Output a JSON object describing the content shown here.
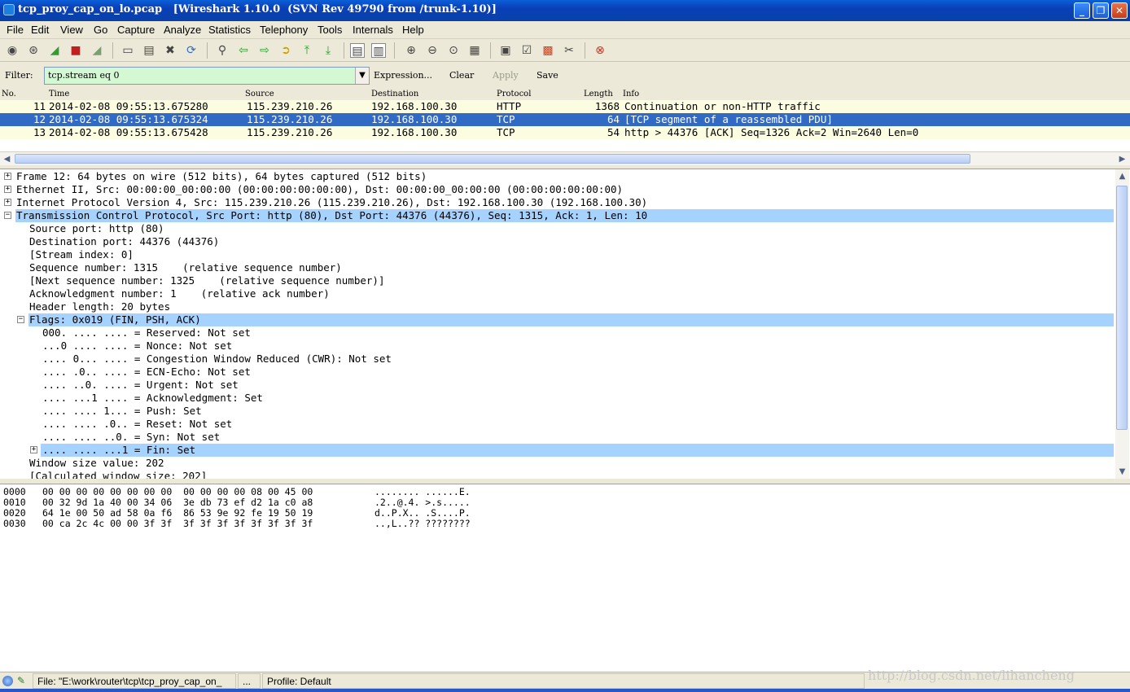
{
  "window": {
    "title": "tcp_proy_cap_on_lo.pcap   [Wireshark 1.10.0  (SVN Rev 49790 from /trunk-1.10)]",
    "icons": {
      "minimize": "minimize-icon",
      "maximize": "restore-icon",
      "close": "close-icon"
    }
  },
  "menu": [
    "File",
    "Edit",
    "View",
    "Go",
    "Capture",
    "Analyze",
    "Statistics",
    "Telephony",
    "Tools",
    "Internals",
    "Help"
  ],
  "toolbar": {
    "icons": [
      "interfaces-icon",
      "options-icon",
      "start-capture-icon",
      "stop-capture-icon",
      "restart-capture-icon",
      "open-file-icon",
      "save-file-icon",
      "close-file-icon",
      "reload-icon",
      "find-packet-icon",
      "go-back-icon",
      "go-forward-icon",
      "go-to-packet-icon",
      "first-packet-icon",
      "last-packet-icon",
      "colorize-icon",
      "auto-scroll-icon",
      "zoom-in-icon",
      "zoom-out-icon",
      "normal-size-icon",
      "resize-columns-icon",
      "capture-filters-icon",
      "display-filters-icon",
      "coloring-rules-icon",
      "preferences-icon",
      "help-icon"
    ]
  },
  "filter": {
    "label": "Filter:",
    "value": "tcp.stream eq 0",
    "expression": "Expression...",
    "clear": "Clear",
    "apply": "Apply",
    "save": "Save"
  },
  "packet_list": {
    "headers": [
      "No.",
      "Time",
      "Source",
      "Destination",
      "Protocol",
      "Length",
      "Info"
    ],
    "rows": [
      {
        "no": "11",
        "time": "2014-02-08 09:55:13.675280",
        "source": "115.239.210.26",
        "destination": "192.168.100.30",
        "protocol": "HTTP",
        "length": "1368",
        "info": "Continuation or non-HTTP traffic"
      },
      {
        "no": "12",
        "time": "2014-02-08 09:55:13.675324",
        "source": "115.239.210.26",
        "destination": "192.168.100.30",
        "protocol": "TCP",
        "length": "64",
        "info": "[TCP segment of a reassembled PDU]"
      },
      {
        "no": "13",
        "time": "2014-02-08 09:55:13.675428",
        "source": "115.239.210.26",
        "destination": "192.168.100.30",
        "protocol": "TCP",
        "length": "54",
        "info": "http > 44376 [ACK] Seq=1326 Ack=2 Win=2640 Len=0"
      }
    ],
    "colors": {
      "row_bg": "#fcfce0",
      "selected_bg": "#316ac5",
      "selected_fg": "#ffffff"
    }
  },
  "details": {
    "lines": [
      "Frame 12: 64 bytes on wire (512 bits), 64 bytes captured (512 bits)",
      "Ethernet II, Src: 00:00:00_00:00:00 (00:00:00:00:00:00), Dst: 00:00:00_00:00:00 (00:00:00:00:00:00)",
      "Internet Protocol Version 4, Src: 115.239.210.26 (115.239.210.26), Dst: 192.168.100.30 (192.168.100.30)",
      "Transmission Control Protocol, Src Port: http (80), Dst Port: 44376 (44376), Seq: 1315, Ack: 1, Len: 10",
      "Source port: http (80)",
      "Destination port: 44376 (44376)",
      "[Stream index: 0]",
      "Sequence number: 1315    (relative sequence number)",
      "[Next sequence number: 1325    (relative sequence number)]",
      "Acknowledgment number: 1    (relative ack number)",
      "Header length: 20 bytes",
      "Flags: 0x019 (FIN, PSH, ACK)",
      "000. .... .... = Reserved: Not set",
      "...0 .... .... = Nonce: Not set",
      ".... 0... .... = Congestion Window Reduced (CWR): Not set",
      ".... .0.. .... = ECN-Echo: Not set",
      ".... ..0. .... = Urgent: Not set",
      ".... ...1 .... = Acknowledgment: Set",
      ".... .... 1... = Push: Set",
      ".... .... .0.. = Reset: Not set",
      ".... .... ..0. = Syn: Not set",
      ".... .... ...1 = Fin: Set",
      "Window size value: 202",
      "[Calculated window size: 202]"
    ],
    "expand_marks": [
      "+",
      "+",
      "+",
      "−",
      "−",
      "+"
    ]
  },
  "hex": {
    "rows": [
      {
        "offset": "0000",
        "bytes": "00 00 00 00 00 00 00 00  00 00 00 00 08 00 45 00",
        "ascii": "........ ......E."
      },
      {
        "offset": "0010",
        "bytes": "00 32 9d 1a 40 00 34 06  3e db 73 ef d2 1a c0 a8",
        "ascii": ".2..@.4. >.s....."
      },
      {
        "offset": "0020",
        "bytes": "64 1e 00 50 ad 58 0a f6  86 53 9e 92 fe 19 50 19",
        "ascii": "d..P.X.. .S....P."
      },
      {
        "offset": "0030",
        "bytes": "00 ca 2c 4c 00 00 3f 3f  3f 3f 3f 3f 3f 3f 3f 3f",
        "ascii": "..,L..?? ????????"
      }
    ]
  },
  "status": {
    "file": "File: \"E:\\work\\router\\tcp\\tcp_proy_cap_on_",
    "packets": "...",
    "profile": "Profile: Default",
    "watermark": "http://blog.csdn.net/lihancheng"
  }
}
